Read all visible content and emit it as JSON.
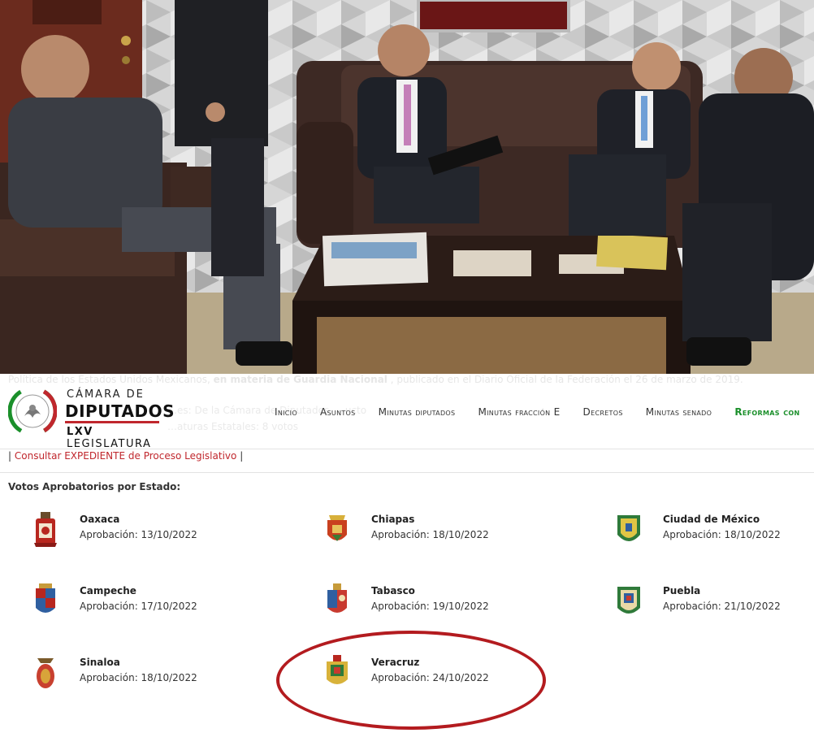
{
  "ghost_text": {
    "line1_prefix": "Política de los Estados Unidos Mexicanos,",
    "line1_bold": "en materia de Guardia Nacional",
    "line1_suffix": ", publicado en el Diario Oficial de la Federación el 26 de marzo de 2019.",
    "line2": "…es: De la Cámara de Diputados, …ucto",
    "line3": "…aturas Estatales: 8 votos"
  },
  "logo": {
    "line1": "CÁMARA DE",
    "line2": "DIPUTADOS",
    "line3_bold": "LXV",
    "line3_rest": "LEGISLATURA"
  },
  "nav": {
    "items": [
      "Inicio",
      "Asuntos",
      "Minutas diputados",
      "Minutas fracción E",
      "Decretos",
      "Minutas senado"
    ],
    "highlight_item": "Reformas con"
  },
  "expediente": {
    "open_pipe": "|",
    "link": "Consultar EXPEDIENTE de Proceso Legislativo",
    "close_pipe": "|"
  },
  "votos_title": "Votos Aprobatorios por Estado:",
  "states": [
    {
      "name": "Oaxaca",
      "date": "Aprobación: 13/10/2022"
    },
    {
      "name": "Chiapas",
      "date": "Aprobación: 18/10/2022"
    },
    {
      "name": "Ciudad de México",
      "date": "Aprobación: 18/10/2022"
    },
    {
      "name": "Campeche",
      "date": "Aprobación: 17/10/2022"
    },
    {
      "name": "Tabasco",
      "date": "Aprobación: 19/10/2022"
    },
    {
      "name": "Puebla",
      "date": "Aprobación: 21/10/2022"
    },
    {
      "name": "Sinaloa",
      "date": "Aprobación: 18/10/2022"
    },
    {
      "name": "Veracruz",
      "date": "Aprobación: 24/10/2022"
    }
  ],
  "colors": {
    "brand_red": "#c0272d",
    "highlight_red": "#b31b1f",
    "nav_green": "#1a8f2a"
  }
}
